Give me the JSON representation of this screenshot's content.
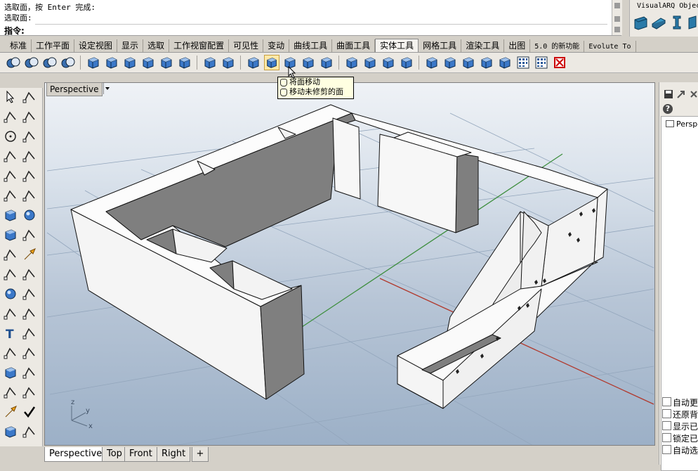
{
  "command": {
    "history": [
      "选取面，按 Enter 完成:",
      "选取面:"
    ],
    "prompt_label": "指令:"
  },
  "visualarq": {
    "title": "VisualARQ Objec"
  },
  "tabs": [
    "标准",
    "工作平面",
    "设定视图",
    "显示",
    "选取",
    "工作视窗配置",
    "可见性",
    "变动",
    "曲线工具",
    "曲面工具",
    "实体工具",
    "网格工具",
    "渲染工具",
    "出图",
    "5.0 的新功能",
    "Evolute To"
  ],
  "active_tab": "实体工具",
  "tooltip": {
    "items": [
      "将面移动",
      "移动未修剪的面"
    ]
  },
  "viewport": {
    "title": "Perspective",
    "axis_labels": {
      "z": "z",
      "y": "y",
      "x": "x"
    }
  },
  "bottom_tabs": [
    "Perspective",
    "Top",
    "Front",
    "Right",
    "+"
  ],
  "right_panel": {
    "layer_item": "Perspe",
    "help": "?",
    "checkboxes": [
      {
        "label": "自动更",
        "checked": false
      },
      {
        "label": "还原背",
        "checked": false
      },
      {
        "label": "显示已",
        "checked": false
      },
      {
        "label": "锁定已",
        "checked": false
      },
      {
        "label": "自动选",
        "checked": false
      }
    ]
  },
  "colors": {
    "accent_active": "#ffe9a8",
    "viewport_sky": "#dbe3ec",
    "grid": "#8aa0b8",
    "x_axis": "#c0392b",
    "y_axis": "#3a8a3a"
  }
}
